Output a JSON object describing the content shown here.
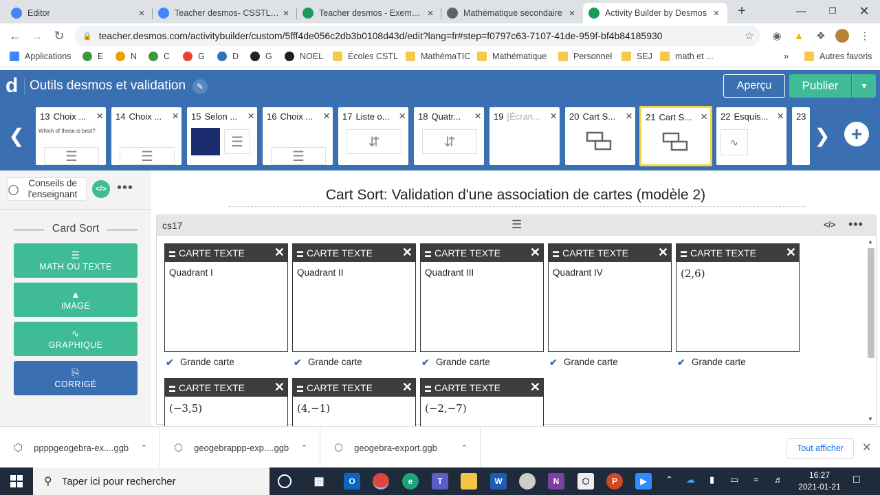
{
  "browser": {
    "tabs": [
      {
        "title": "Editor",
        "icon": "chrome-icon",
        "color": "#4285f4"
      },
      {
        "title": "Teacher desmos- CSSTL - M",
        "icon": "chrome-icon",
        "color": "#4285f4"
      },
      {
        "title": "Teacher desmos - Exemples",
        "icon": "desmos-ab-icon",
        "color": "#1a9c5b"
      },
      {
        "title": "Mathématique secondaire",
        "icon": "globe-icon",
        "color": "#5f6368"
      },
      {
        "title": "Activity Builder by Desmos",
        "icon": "desmos-ab-icon",
        "color": "#1a9c5b",
        "active": true
      }
    ],
    "new_tab": "+",
    "url": "teacher.desmos.com/activitybuilder/custom/5fff4de056c2db3b0108d43d/edit?lang=fr#step=f0797c63-7107-41de-959f-bf4b84185930",
    "bookmarks": [
      {
        "label": "Applications",
        "icon": "apps-grid-icon"
      },
      {
        "label": "E",
        "icon": "leaf-icon"
      },
      {
        "label": "N",
        "icon": "n-icon"
      },
      {
        "label": "C",
        "icon": "leaf-icon"
      },
      {
        "label": "G",
        "icon": "google-icon"
      },
      {
        "label": "D",
        "icon": "desmos-icon"
      },
      {
        "label": "G",
        "icon": "chrome-icon"
      },
      {
        "label": "NOEL",
        "icon": "chrome-icon"
      },
      {
        "label": "Écoles CSTL",
        "icon": "folder-icon"
      },
      {
        "label": "MathémaTIC",
        "icon": "folder-icon"
      },
      {
        "label": "Mathématique",
        "icon": "folder-icon"
      },
      {
        "label": "Personnel",
        "icon": "folder-icon"
      },
      {
        "label": "SEJ",
        "icon": "folder-icon"
      },
      {
        "label": "math et ...",
        "icon": "folder-icon"
      }
    ],
    "bookmarks_more": "»",
    "other_bookmarks": "Autres favoris"
  },
  "desmos": {
    "logo": "d",
    "title": "Outils desmos et validation",
    "preview_label": "Aperçu",
    "publish_label": "Publier",
    "screens": [
      {
        "num": "13",
        "label": "Choix ...",
        "preview": "text",
        "preview_text": "Which of these is best?"
      },
      {
        "num": "14",
        "label": "Choix ...",
        "preview": "list"
      },
      {
        "num": "15",
        "label": "Selon ...",
        "preview": "image-list"
      },
      {
        "num": "16",
        "label": "Choix ...",
        "preview": "list"
      },
      {
        "num": "17",
        "label": "Liste o...",
        "preview": "order"
      },
      {
        "num": "18",
        "label": "Quatr...",
        "preview": "order"
      },
      {
        "num": "19",
        "label": "[Écran...",
        "preview": "empty",
        "dim": true
      },
      {
        "num": "20",
        "label": "Cart S...",
        "preview": "cards"
      },
      {
        "num": "21",
        "label": "Cart S...",
        "preview": "cards",
        "selected": true
      },
      {
        "num": "22",
        "label": "Esquis...",
        "preview": "sketch"
      },
      {
        "num": "23",
        "label": "",
        "preview": "empty"
      }
    ],
    "teacher_tips": "Conseils de l'enseignant",
    "card_sort_header": "Card Sort",
    "component_buttons": [
      {
        "label": "MATH OU TEXTE",
        "icon": "text-icon",
        "color": "#3fbc95"
      },
      {
        "label": "IMAGE",
        "icon": "image-icon",
        "color": "#3fbc95"
      },
      {
        "label": "GRAPHIQUE",
        "icon": "graph-icon",
        "color": "#3fbc95"
      },
      {
        "label": "CORRIGÉ",
        "icon": "clipboard-icon",
        "color": "#3a6fb2"
      }
    ],
    "screen_title": "Cart Sort:  Validation d'une association de cartes (modèle 2)",
    "component_name": "cs17",
    "card_type_label": "CARTE TEXTE",
    "big_card_label": "Grande carte",
    "cards": [
      {
        "content": "Quadrant I",
        "math": false,
        "big": true
      },
      {
        "content": "Quadrant II",
        "math": false,
        "big": true
      },
      {
        "content": "Quadrant III",
        "math": false,
        "big": true
      },
      {
        "content": "Quadrant IV",
        "math": false,
        "big": true
      },
      {
        "content": "(2,6)",
        "math": true,
        "big": true
      },
      {
        "content": "(−3,5)",
        "math": true
      },
      {
        "content": "(4,−1)",
        "math": true
      },
      {
        "content": "(−2,−7)",
        "math": true
      }
    ]
  },
  "downloads": {
    "items": [
      "ppppgeogebra-ex....ggb",
      "geogebrappp-exp....ggb",
      "geogebra-export.ggb"
    ],
    "show_all": "Tout afficher"
  },
  "taskbar": {
    "search_placeholder": "Taper ici pour rechercher",
    "time": "16:27",
    "date": "2021-01-21"
  }
}
